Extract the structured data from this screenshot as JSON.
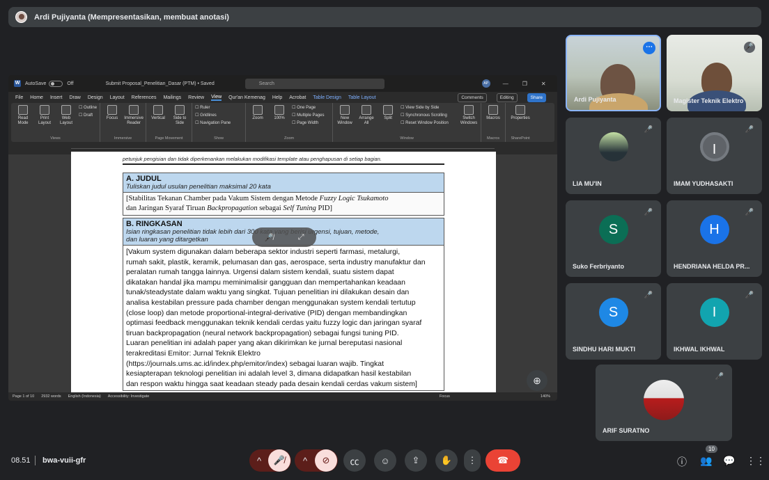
{
  "presenter": {
    "name": "Ardi Pujiyanta (Mempresentasikan, membuat anotasi)"
  },
  "word": {
    "autosave": "AutoSave",
    "autosave_state": "Off",
    "doc_title": "Submit Proposal_Penelitian_Dasar (PTM) • Saved",
    "search_placeholder": "Search",
    "user_initials": "AP",
    "menu": [
      "File",
      "Home",
      "Insert",
      "Draw",
      "Design",
      "Layout",
      "References",
      "Mailings",
      "Review",
      "View",
      "Qur'an Kemenag",
      "Help",
      "Acrobat",
      "Table Design",
      "Table Layout"
    ],
    "active_tab": "View",
    "comments_label": "Comments",
    "editing_label": "Editing",
    "share_label": "Share",
    "ribbon": {
      "views": {
        "label": "Views",
        "items": [
          "Read Mode",
          "Print Layout",
          "Web Layout"
        ],
        "checks": [
          "Outline",
          "Draft"
        ]
      },
      "immersive": {
        "label": "Immersive",
        "items": [
          "Focus",
          "Immersive Reader"
        ]
      },
      "page_movement": {
        "label": "Page Movement",
        "items": [
          "Vertical",
          "Side to Side"
        ]
      },
      "show": {
        "label": "Show",
        "checks": [
          "Ruler",
          "Gridlines",
          "Navigation Pane"
        ]
      },
      "zoom": {
        "label": "Zoom",
        "items": [
          "Zoom",
          "100%"
        ],
        "checks": [
          "One Page",
          "Multiple Pages",
          "Page Width"
        ]
      },
      "window": {
        "label": "Window",
        "items": [
          "New Window",
          "Arrange All",
          "Split"
        ],
        "checks": [
          "View Side by Side",
          "Synchronous Scrolling",
          "Reset Window Position"
        ],
        "switch": "Switch Windows"
      },
      "macros": {
        "label": "Macros",
        "items": [
          "Macros"
        ]
      },
      "sharepoint": {
        "label": "SharePoint",
        "items": [
          "Properties"
        ]
      }
    },
    "status": {
      "page": "Page 1 of 10",
      "words": "2932 words",
      "lang": "English (Indonesia)",
      "accessibility": "Accessibility: Investigate",
      "focus": "Focus",
      "zoom": "140%"
    }
  },
  "document": {
    "top_note": "petunjuk pengisian dan tidak diperkenankan melakukan modifikasi template atau penghapusan di setiap bagian.",
    "judul": {
      "title": "A. JUDUL",
      "subtitle": "Tuliskan judul usulan penelitian maksimal 20 kata",
      "line1_a": "[Stabilitas Tekanan Chamber pada Vakum Sistem dengan Metode ",
      "line1_em": "Fuzzy Logic Tsukamoto",
      "line2_a": "dan Jaringan Syaraf Tiruan ",
      "line2_em1": "Backpropagation",
      "line2_b": " sebagai ",
      "line2_em2": "Self Tuning",
      "line2_c": " PID]"
    },
    "ringkasan": {
      "title": "B. RINGKASAN",
      "subtitle1": "Isian ringkasan penelitian tidak lebih dari 300 kata yang berisi urgensi, tujuan, metode,",
      "subtitle2": "dan luaran yang ditargetkan",
      "body": [
        "[Vakum system digunakan dalam beberapa sektor industri seperti farmasi, metalurgi,",
        "rumah sakit, plastik, keramik, pelumasan dan gas, aerospace, serta industry manufaktur dan",
        "peralatan rumah tangga lainnya. Urgensi dalam sistem kendali, suatu sistem dapat",
        "dikatakan handal jika mampu meminimalisir gangguan dan mempertahankan keadaan",
        "tunak/steadystate dalam waktu yang singkat. Tujuan penelitian ini dilakukan desain dan",
        "analisa kestabilan pressure pada chamber dengan menggunakan system kendali tertutup",
        "(close loop) dan metode proportional-integral-derivative (PID) dengan membandingkan",
        "optimasi feedback menggunakan teknik kendali cerdas yaitu fuzzy logic dan jaringan syaraf",
        "tiruan backpropagation (neural network backpropagation) sebagai fungsi tuning PID.",
        "Luaran penelitian ini adalah paper yang akan dikirimkan ke jurnal bereputasi nasional",
        "terakreditasi Emitor: Jurnal Teknik Elektro",
        "(https://journals.ums.ac.id/index.php/emitor/index) sebagai luaran wajib. Tingkat",
        "kesiapterapan teknologi penelitian ini adalah level 3, dimana didapatkan hasil kestabilan",
        "dan respon waktu hingga saat keadaan steady pada desain kendali cerdas vakum sistem]"
      ]
    }
  },
  "participants": [
    {
      "name": "Ardi Pujiyanta",
      "type": "video"
    },
    {
      "name": "Magister Teknik Elektro",
      "type": "video"
    },
    {
      "name": "LIA MU'IN",
      "type": "photo"
    },
    {
      "name": "IMAM YUDHASAKTI",
      "type": "letter",
      "letter": "I",
      "color": "#5f6368"
    },
    {
      "name": "Suko Ferbriyanto",
      "type": "letter",
      "letter": "S",
      "color": "#0b6e55"
    },
    {
      "name": "HENDRIANA HELDA PR...",
      "type": "letter",
      "letter": "H",
      "color": "#1a73e8"
    },
    {
      "name": "SINDHU HARI MUKTI",
      "type": "letter",
      "letter": "S",
      "color": "#1e88e5"
    },
    {
      "name": "IKHWAL IKHWAL",
      "type": "letter",
      "letter": "I",
      "color": "#12a4af"
    },
    {
      "name": "ARIF SURATNO",
      "type": "photo"
    }
  ],
  "bottom": {
    "time": "08.51",
    "meeting_code": "bwa-vuii-gfr",
    "participant_count": "10"
  }
}
